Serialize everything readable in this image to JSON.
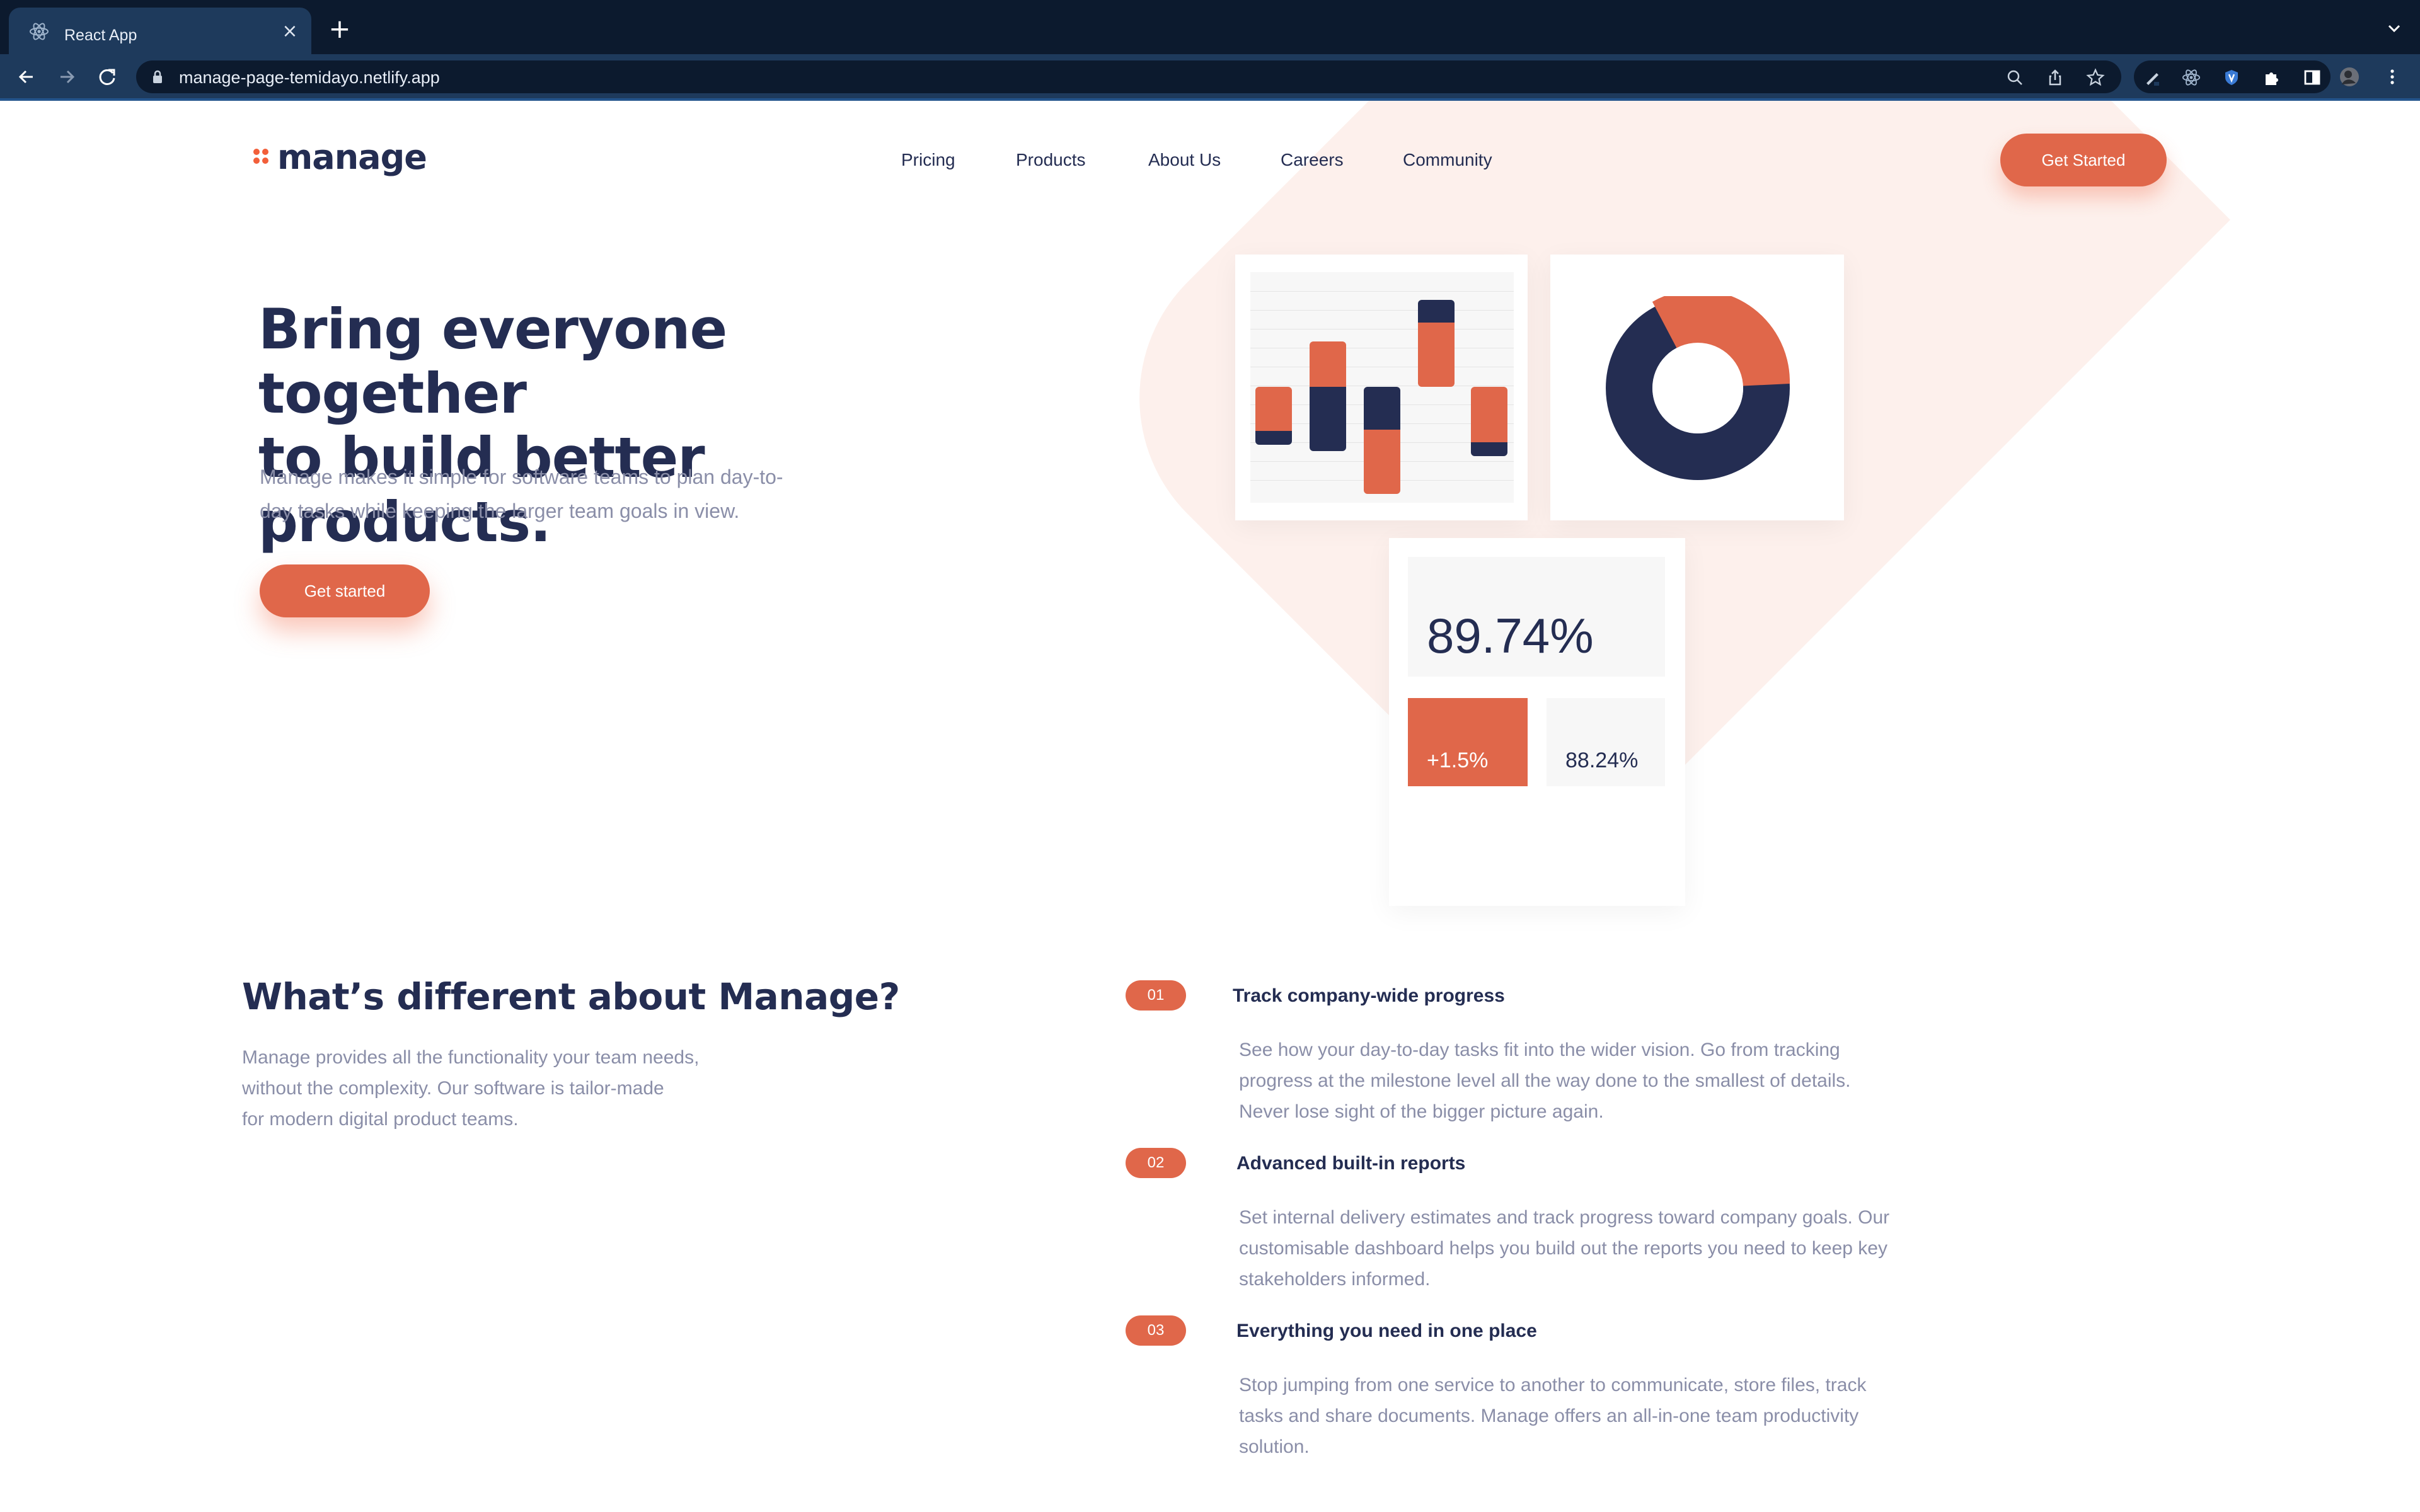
{
  "browser": {
    "tab_title": "React App",
    "url": "manage-page-temidayo.netlify.app"
  },
  "header": {
    "logo_text": "manage",
    "nav": [
      "Pricing",
      "Products",
      "About Us",
      "Careers",
      "Community"
    ],
    "cta_label": "Get Started"
  },
  "hero": {
    "title_line1": "Bring everyone together",
    "title_line2": "to build better products.",
    "subtitle_line1": "Manage makes it simple for software teams to plan day-to-",
    "subtitle_line2": "day tasks while keeping the larger team goals in view.",
    "cta_label": "Get started"
  },
  "illustration": {
    "stat_main": "89.74%",
    "stat_change": "+1.5%",
    "stat_secondary": "88.24%",
    "colors": {
      "accent": "#e0674a",
      "navy": "#242d52"
    }
  },
  "different": {
    "title": "What’s different about Manage?",
    "desc_line1": "Manage provides all the functionality your team needs,",
    "desc_line2": "without the complexity. Our software is tailor-made",
    "desc_line3": "for modern digital product teams.",
    "features": [
      {
        "number": "01",
        "title": "Track company-wide progress",
        "line1": "See how your day-to-day tasks fit into the wider vision. Go from tracking",
        "line2": "progress at the milestone level all the way done to the smallest of details.",
        "line3": "Never lose sight of the bigger picture again."
      },
      {
        "number": "02",
        "title": "Advanced built-in reports",
        "line1": "Set internal delivery estimates and track progress toward company goals. Our",
        "line2": "customisable dashboard helps you build out the reports you need to keep key",
        "line3": "stakeholders informed."
      },
      {
        "number": "03",
        "title": "Everything you need in one place",
        "line1": "Stop jumping from one service to another to communicate, store files, track",
        "line2": "tasks and share documents. Manage offers an all-in-one team productivity",
        "line3": "solution."
      }
    ]
  }
}
